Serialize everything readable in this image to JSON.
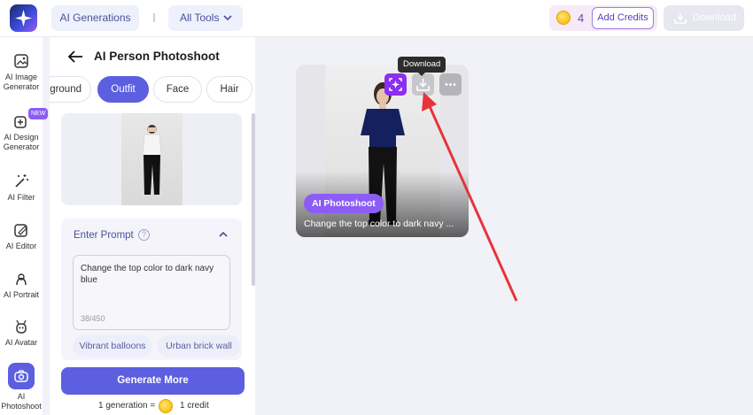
{
  "header": {
    "ai_generations": "AI Generations",
    "all_tools": "All Tools",
    "credit_count": "4",
    "add_credits": "Add Credits",
    "download": "Download"
  },
  "sidebar": {
    "items": [
      {
        "label": "AI Image Generator",
        "icon": "image-generator-icon"
      },
      {
        "label": "AI Design Generator",
        "icon": "design-generator-icon",
        "badge": "NEW"
      },
      {
        "label": "AI Filter",
        "icon": "magic-wand-icon"
      },
      {
        "label": "AI Editor",
        "icon": "editor-icon"
      },
      {
        "label": "AI Portrait",
        "icon": "portrait-icon"
      },
      {
        "label": "AI Avatar",
        "icon": "avatar-icon"
      },
      {
        "label": "AI Photoshoot",
        "icon": "camera-icon",
        "active": true
      }
    ]
  },
  "panel": {
    "title": "AI Person Photoshoot",
    "tabs": [
      {
        "label": "Background",
        "visible_text": "ground"
      },
      {
        "label": "Outfit",
        "active": true
      },
      {
        "label": "Face"
      },
      {
        "label": "Hair"
      }
    ],
    "prompt": {
      "heading": "Enter Prompt",
      "help": "?",
      "value": "Change the top color to dark navy blue",
      "counter": "38/450"
    },
    "suggestions": [
      "Vibrant balloons",
      "Urban brick wall"
    ],
    "generate_button": "Generate More",
    "cost_left": "1 generation =",
    "cost_right": "1 credit"
  },
  "result": {
    "tag": "AI Photoshoot",
    "caption": "Change the top color to dark navy ...",
    "tooltip": "Download"
  },
  "colors": {
    "accent": "#5b5fe0",
    "purple": "#8b5cf6",
    "annotation_arrow": "#e5353a"
  }
}
